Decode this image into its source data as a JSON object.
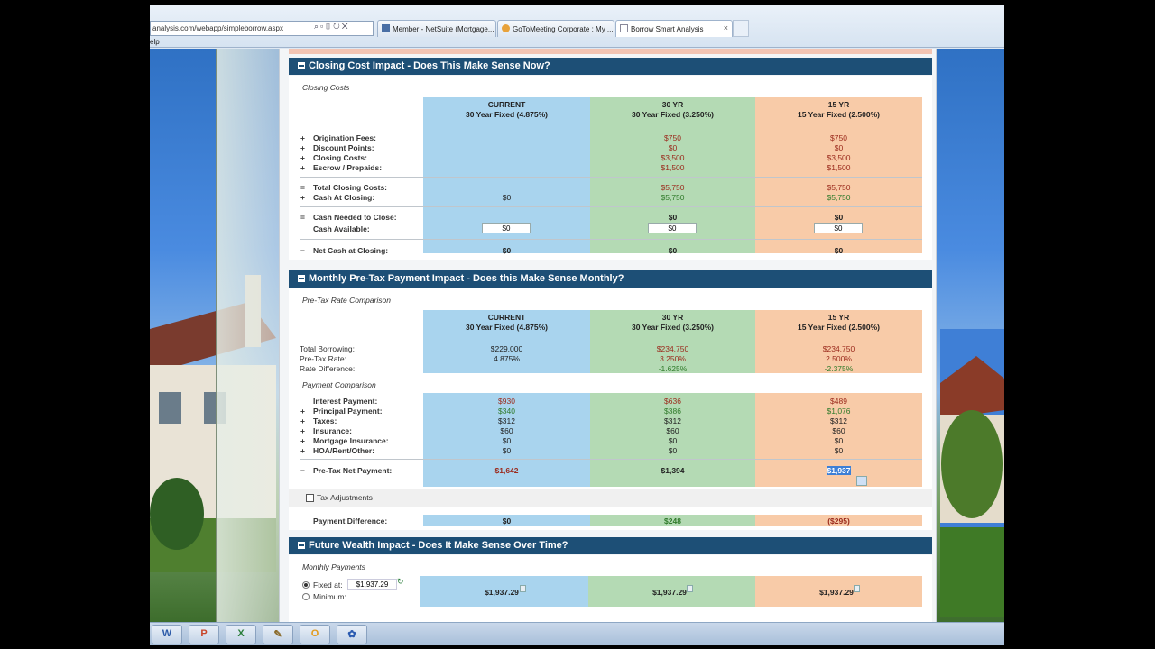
{
  "browser": {
    "address": "analysis.com/webapp/simpleborrow.aspx",
    "menu_text": "elp",
    "tabs": [
      {
        "label": "Member - NetSuite (Mortgage...",
        "icon": "netsuite-icon"
      },
      {
        "label": "GoToMeeting Corporate : My ...",
        "icon": "gotomeeting-icon"
      },
      {
        "label": "Borrow Smart Analysis",
        "icon": "page-icon",
        "active": true
      }
    ],
    "close_symbol": "×"
  },
  "closing": {
    "title": "Closing Cost Impact - Does This Make Sense Now?",
    "subtitle": "Closing Costs",
    "columns": [
      {
        "name": "CURRENT",
        "desc": "30 Year Fixed (4.875%)"
      },
      {
        "name": "30 YR",
        "desc": "30 Year Fixed (3.250%)"
      },
      {
        "name": "15 YR",
        "desc": "15 Year Fixed (2.500%)"
      }
    ],
    "rows": [
      {
        "sign": "+",
        "label": "Origination Fees:",
        "v": [
          "",
          "$750",
          "$750"
        ]
      },
      {
        "sign": "+",
        "label": "Discount Points:",
        "v": [
          "",
          "$0",
          "$0"
        ]
      },
      {
        "sign": "+",
        "label": "Closing Costs:",
        "v": [
          "",
          "$3,500",
          "$3,500"
        ]
      },
      {
        "sign": "+",
        "label": "Escrow / Prepaids:",
        "v": [
          "",
          "$1,500",
          "$1,500"
        ]
      }
    ],
    "total_label": "Total Closing Costs:",
    "total_values": [
      "",
      "$5,750",
      "$5,750"
    ],
    "cash_closing_label": "Cash At Closing:",
    "cash_closing_values": [
      "$0",
      "$5,750",
      "$5,750"
    ],
    "needed_label": "Cash Needed to Close:",
    "needed_values": [
      "",
      "$0",
      "$0"
    ],
    "available_label": "Cash Available:",
    "available_values": [
      "$0",
      "$0",
      "$0"
    ],
    "net_label": "Net Cash at Closing:",
    "net_values": [
      "$0",
      "$0",
      "$0"
    ],
    "signs": {
      "eq": "=",
      "plus": "+",
      "minus": "−"
    }
  },
  "monthly": {
    "title": "Monthly Pre-Tax Payment Impact - Does this Make Sense Monthly?",
    "subtitle": "Pre-Tax Rate Comparison",
    "columns": [
      {
        "name": "CURRENT",
        "desc": "30 Year Fixed (4.875%)"
      },
      {
        "name": "30 YR",
        "desc": "30 Year Fixed (3.250%)"
      },
      {
        "name": "15 YR",
        "desc": "15 Year Fixed (2.500%)"
      }
    ],
    "rate_rows": [
      {
        "label": "Total Borrowing:",
        "v": [
          "$229,000",
          "$234,750",
          "$234,750"
        ]
      },
      {
        "label": "Pre-Tax Rate:",
        "v": [
          "4.875%",
          "3.250%",
          "2.500%"
        ]
      },
      {
        "label": "Rate Difference:",
        "v": [
          "",
          "-1.625%",
          "-2.375%"
        ]
      }
    ],
    "payment_subtitle": "Payment Comparison",
    "pay_rows": [
      {
        "sign": "",
        "label": "Interest Payment:",
        "v": [
          "$930",
          "$636",
          "$489"
        ]
      },
      {
        "sign": "+",
        "label": "Principal Payment:",
        "v": [
          "$340",
          "$386",
          "$1,076"
        ]
      },
      {
        "sign": "+",
        "label": "Taxes:",
        "v": [
          "$312",
          "$312",
          "$312"
        ]
      },
      {
        "sign": "+",
        "label": "Insurance:",
        "v": [
          "$60",
          "$60",
          "$60"
        ]
      },
      {
        "sign": "+",
        "label": "Mortgage Insurance:",
        "v": [
          "$0",
          "$0",
          "$0"
        ]
      },
      {
        "sign": "+",
        "label": "HOA/Rent/Other:",
        "v": [
          "$0",
          "$0",
          "$0"
        ]
      }
    ],
    "net_label": "Pre-Tax Net Payment:",
    "net_values": [
      "$1,642",
      "$1,394",
      "$1,937"
    ],
    "tax_adjustments_label": "Tax Adjustments",
    "diff_label": "Payment Difference:",
    "diff_values": [
      "$0",
      "$248",
      "($295)"
    ]
  },
  "wealth": {
    "title": "Future Wealth Impact - Does It Make Sense Over Time?",
    "subtitle": "Monthly Payments",
    "fixed_label": "Fixed at:",
    "fixed_value": "$1,937.29",
    "minimum_label": "Minimum:",
    "values": [
      "$1,937.29",
      "$1,937.29",
      "$1,937.29"
    ]
  },
  "taskbar": [
    {
      "icon": "word-icon",
      "label": "W",
      "color": "#2b5aa8"
    },
    {
      "icon": "powerpoint-icon",
      "label": "P",
      "color": "#c8452a"
    },
    {
      "icon": "excel-icon",
      "label": "X",
      "color": "#2a7d3a"
    },
    {
      "icon": "pen-icon",
      "label": "✎",
      "color": "#8a6a2a"
    },
    {
      "icon": "outlook-icon",
      "label": "O",
      "color": "#e39a1a"
    },
    {
      "icon": "network-icon",
      "label": "✿",
      "color": "#2a5ab0"
    }
  ]
}
